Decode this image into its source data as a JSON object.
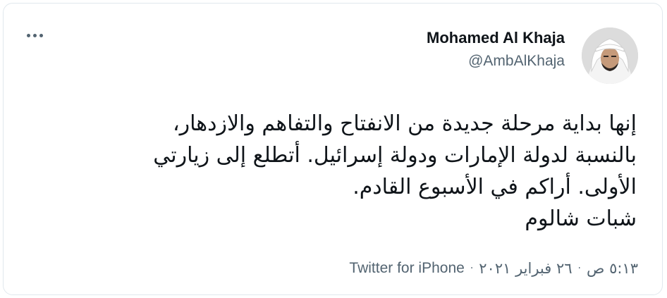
{
  "author": {
    "name": "Mohamed Al Khaja",
    "handle": "@AmbAlKhaja"
  },
  "tweet": {
    "lines": [
      "إنها بداية مرحلة جديدة من الانفتاح والتفاهم والازدهار،",
      "بالنسبة لدولة الإمارات ودولة إسرائيل. أتطلع إلى زيارتي",
      "الأولى. أراكم في الأسبوع القادم.",
      "شبات شالوم"
    ],
    "time": "٥:١٣ ص",
    "date": "٢٦ فبراير ٢٠٢١",
    "source": "Twitter for iPhone",
    "separator": "·"
  },
  "icons": {
    "more": "more-horizontal-icon"
  },
  "colors": {
    "text": "#0f1419",
    "secondary": "#536471",
    "border": "#e1e8ed"
  }
}
